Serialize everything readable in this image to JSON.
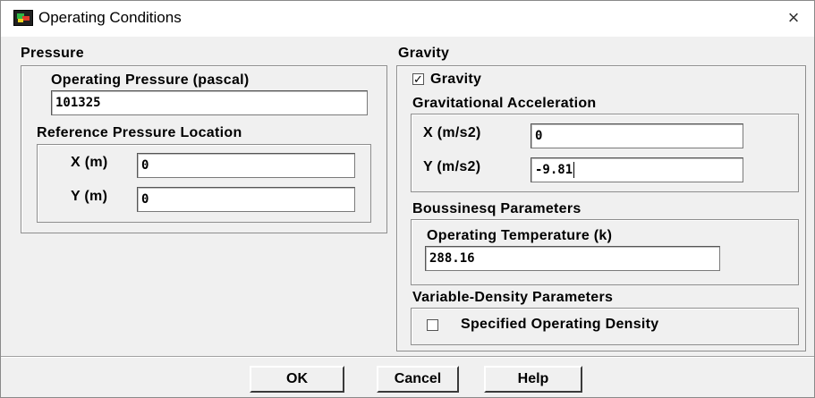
{
  "window": {
    "title": "Operating Conditions",
    "close_glyph": "×",
    "icon": "app-icon"
  },
  "pressure": {
    "heading": "Pressure",
    "operating_pressure_label": "Operating Pressure (pascal)",
    "operating_pressure_value": "101325",
    "ref_location_label": "Reference Pressure Location",
    "x_label": "X (m)",
    "x_value": "0",
    "y_label": "Y (m)",
    "y_value": "0"
  },
  "gravity": {
    "heading": "Gravity",
    "checkbox_label": "Gravity",
    "checkbox_checked": true,
    "check_glyph": "✓",
    "accel_label": "Gravitational Acceleration",
    "x_label": "X (m/s2)",
    "x_value": "0",
    "y_label": "Y (m/s2)",
    "y_value": "-9.81"
  },
  "boussinesq": {
    "heading": "Boussinesq Parameters",
    "temp_label": "Operating Temperature (k)",
    "temp_value": "288.16"
  },
  "variable_density": {
    "heading": "Variable-Density Parameters",
    "checkbox_label": "Specified Operating Density",
    "checkbox_checked": false
  },
  "buttons": {
    "ok": "OK",
    "cancel": "Cancel",
    "help": "Help"
  }
}
